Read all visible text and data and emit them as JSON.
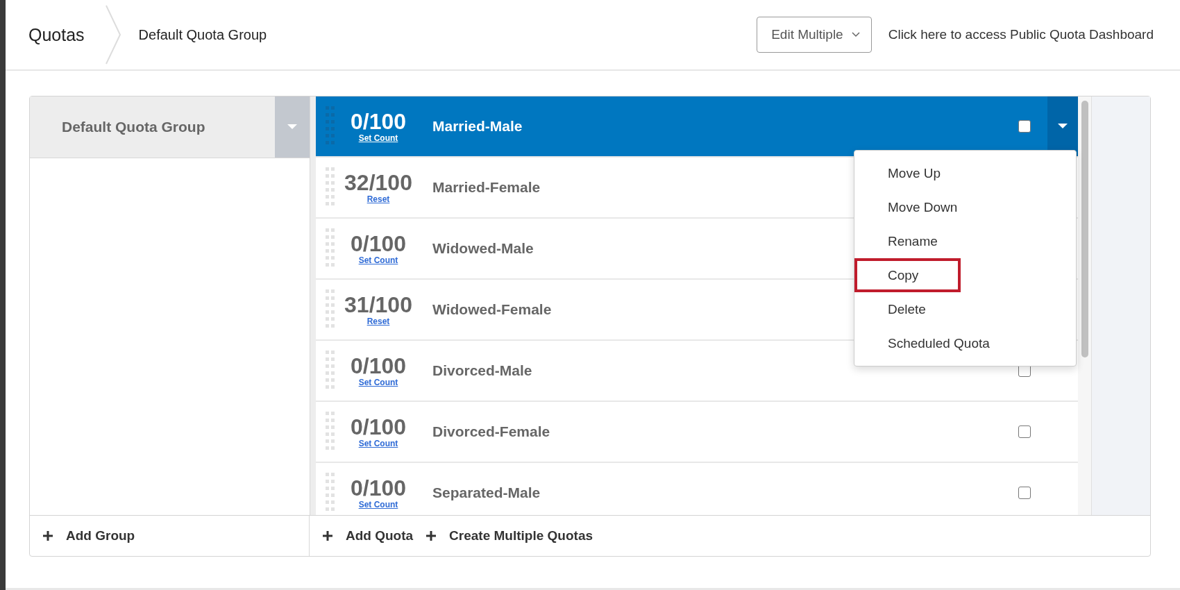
{
  "header": {
    "title": "Quotas",
    "breadcrumb": "Default Quota Group",
    "edit_button": "Edit Multiple",
    "dashboard_link": "Click here to access Public Quota Dashboard"
  },
  "groups": [
    {
      "name": "Default Quota Group",
      "selected": true
    }
  ],
  "quotas": [
    {
      "count": "0/100",
      "action": "Set Count",
      "name": "Married-Male",
      "selected": true,
      "checked": false
    },
    {
      "count": "32/100",
      "action": "Reset",
      "name": "Married-Female",
      "selected": false
    },
    {
      "count": "0/100",
      "action": "Set Count",
      "name": "Widowed-Male",
      "selected": false
    },
    {
      "count": "31/100",
      "action": "Reset",
      "name": "Widowed-Female",
      "selected": false
    },
    {
      "count": "0/100",
      "action": "Set Count",
      "name": "Divorced-Male",
      "selected": false,
      "checked": false
    },
    {
      "count": "0/100",
      "action": "Set Count",
      "name": "Divorced-Female",
      "selected": false,
      "checked": false
    },
    {
      "count": "0/100",
      "action": "Set Count",
      "name": "Separated-Male",
      "selected": false,
      "checked": false
    }
  ],
  "menu": {
    "items": [
      {
        "label": "Move Up",
        "highlighted": false
      },
      {
        "label": "Move Down",
        "highlighted": false
      },
      {
        "label": "Rename",
        "highlighted": false
      },
      {
        "label": "Copy",
        "highlighted": true
      },
      {
        "label": "Delete",
        "highlighted": false
      },
      {
        "label": "Scheduled Quota",
        "highlighted": false
      }
    ]
  },
  "footer": {
    "add_group": "Add Group",
    "add_quota": "Add Quota",
    "create_multiple": "Create Multiple Quotas"
  }
}
